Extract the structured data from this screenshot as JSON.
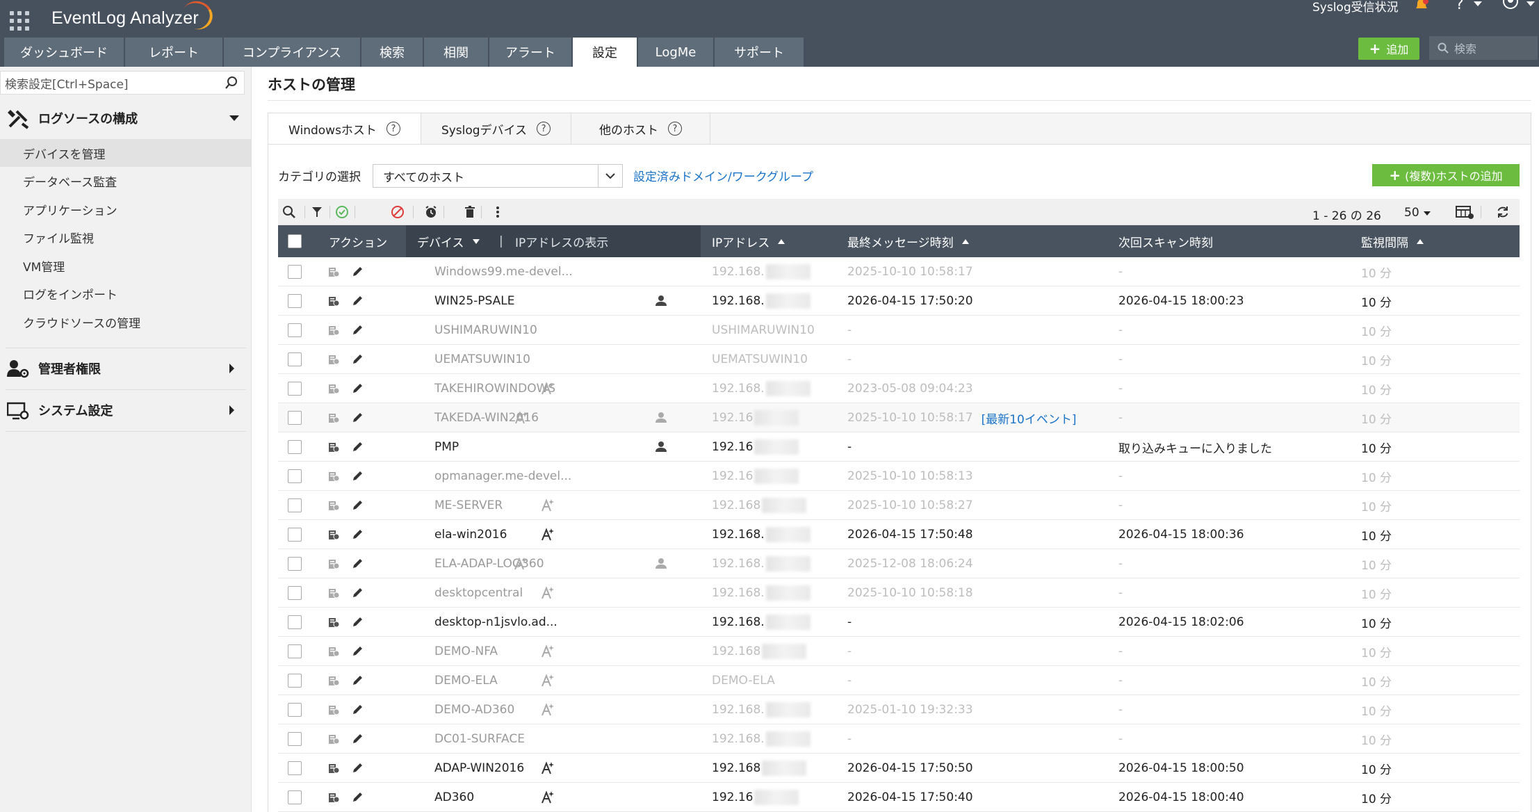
{
  "app": {
    "title": "EventLog Analyzer",
    "syslog_status": "Syslog受信状況",
    "add_label": "追加",
    "search_placeholder": "検索"
  },
  "nav_tabs": [
    {
      "label": "ダッシュボード",
      "w": 0
    },
    {
      "label": "レポート"
    },
    {
      "label": "コンプライアンス"
    },
    {
      "label": "検索"
    },
    {
      "label": "相関"
    },
    {
      "label": "アラート"
    },
    {
      "label": "設定"
    },
    {
      "label": "LogMe"
    },
    {
      "label": "サポート"
    }
  ],
  "active_tab": "設定",
  "sidebar": {
    "search_placeholder": "検索設定[Ctrl+Space]",
    "section_log": "ログソースの構成",
    "items": [
      "デバイスを管理",
      "データベース監査",
      "アプリケーション",
      "ファイル監視",
      "VM管理",
      "ログをインポート",
      "クラウドソースの管理"
    ],
    "section_admin": "管理者権限",
    "section_system": "システム設定"
  },
  "page": {
    "title": "ホストの管理",
    "host_tabs": [
      "Windowsホスト",
      "Syslogデバイス",
      "他のホスト"
    ],
    "category_label": "カテゴリの選択",
    "category_value": "すべてのホスト",
    "domain_link": "設定済みドメイン/ワークグループ",
    "add_hosts_label": "(複数)ホストの追加",
    "pager": "1 - 26 の 26",
    "page_size": "50"
  },
  "table": {
    "headers": {
      "action": "アクション",
      "device": "デバイス",
      "show_ip": "IPアドレスの表示",
      "ip": "IPアドレス",
      "last_msg": "最終メッセージ時刻",
      "next_scan": "次回スキャン時刻",
      "interval": "監視間隔"
    },
    "recent_events_label": "[最新10イベント]",
    "rows": [
      {
        "device": "Windows99.me-devel...",
        "ip": "192.168.",
        "last": "2025-10-10 10:58:17",
        "next": "-",
        "interval": "10 分",
        "dim": true
      },
      {
        "device": "WIN25-PSALE",
        "ip": "192.168.",
        "last": "2026-04-15 17:50:20",
        "next": "2026-04-15 18:00:23",
        "interval": "10 分",
        "dim": false,
        "user": true
      },
      {
        "device": "USHIMARUWIN10",
        "ip": "USHIMARUWIN10",
        "last": "-",
        "next": "-",
        "interval": "10 分",
        "dim": true,
        "noblur": true
      },
      {
        "device": "UEMATSUWIN10",
        "ip": "UEMATSUWIN10",
        "last": "-",
        "next": "-",
        "interval": "10 分",
        "dim": true,
        "noblur": true
      },
      {
        "device": "TAKEHIROWINDOWS",
        "ip": "192.168.",
        "last": "2023-05-08 09:04:23",
        "next": "-",
        "interval": "10 分",
        "dim": true,
        "star": "right"
      },
      {
        "device": "TAKEDA-WIN2016",
        "ip": "192.16",
        "last": "2025-10-10 10:58:17",
        "next": "-",
        "interval": "10 分",
        "dim": true,
        "star": "inline",
        "user": true,
        "events": true
      },
      {
        "device": "PMP",
        "ip": "192.16",
        "last": "-",
        "next": "取り込みキューに入りました",
        "interval": "10 分",
        "dim": false,
        "user": true
      },
      {
        "device": "opmanager.me-devel...",
        "ip": "192.16",
        "last": "2025-10-10 10:58:13",
        "next": "-",
        "interval": "10 分",
        "dim": true
      },
      {
        "device": "ME-SERVER",
        "ip": "192.168",
        "last": "2025-10-10 10:58:27",
        "next": "-",
        "interval": "10 分",
        "dim": true,
        "star": "right"
      },
      {
        "device": "ela-win2016",
        "ip": "192.168.",
        "last": "2026-04-15 17:50:48",
        "next": "2026-04-15 18:00:36",
        "interval": "10 分",
        "dim": false,
        "star": "right"
      },
      {
        "device": "ELA-ADAP-LOG360",
        "ip": "192.168.",
        "last": "2025-12-08 18:06:24",
        "next": "-",
        "interval": "10 分",
        "dim": true,
        "star": "inline",
        "user": true
      },
      {
        "device": "desktopcentral",
        "ip": "192.168.",
        "last": "2025-10-10 10:58:18",
        "next": "-",
        "interval": "10 分",
        "dim": true,
        "star": "right"
      },
      {
        "device": "desktop-n1jsvlo.ad...",
        "ip": "192.168.",
        "last": "-",
        "next": "2026-04-15 18:02:06",
        "interval": "10 分",
        "dim": false
      },
      {
        "device": "DEMO-NFA",
        "ip": "192.168",
        "last": "-",
        "next": "-",
        "interval": "10 分",
        "dim": true,
        "star": "right"
      },
      {
        "device": "DEMO-ELA",
        "ip": "DEMO-ELA",
        "last": "-",
        "next": "-",
        "interval": "10 分",
        "dim": true,
        "star": "right",
        "noblur": true
      },
      {
        "device": "DEMO-AD360",
        "ip": "192.168.",
        "last": "2025-01-10 19:32:33",
        "next": "-",
        "interval": "10 分",
        "dim": true,
        "star": "right"
      },
      {
        "device": "DC01-SURFACE",
        "ip": "192.168.",
        "last": "-",
        "next": "-",
        "interval": "10 分",
        "dim": true
      },
      {
        "device": "ADAP-WIN2016",
        "ip": "192.168",
        "last": "2026-04-15 17:50:50",
        "next": "2026-04-15 18:00:50",
        "interval": "10 分",
        "dim": false,
        "star": "right"
      },
      {
        "device": "AD360",
        "ip": "192.16",
        "last": "2026-04-15 17:50:40",
        "next": "2026-04-15 18:00:40",
        "interval": "10 分",
        "dim": false,
        "star": "right"
      }
    ]
  },
  "colors": {
    "topbar": "#47515d",
    "accent_green": "#6cbc3f",
    "link": "#1a73c8"
  }
}
